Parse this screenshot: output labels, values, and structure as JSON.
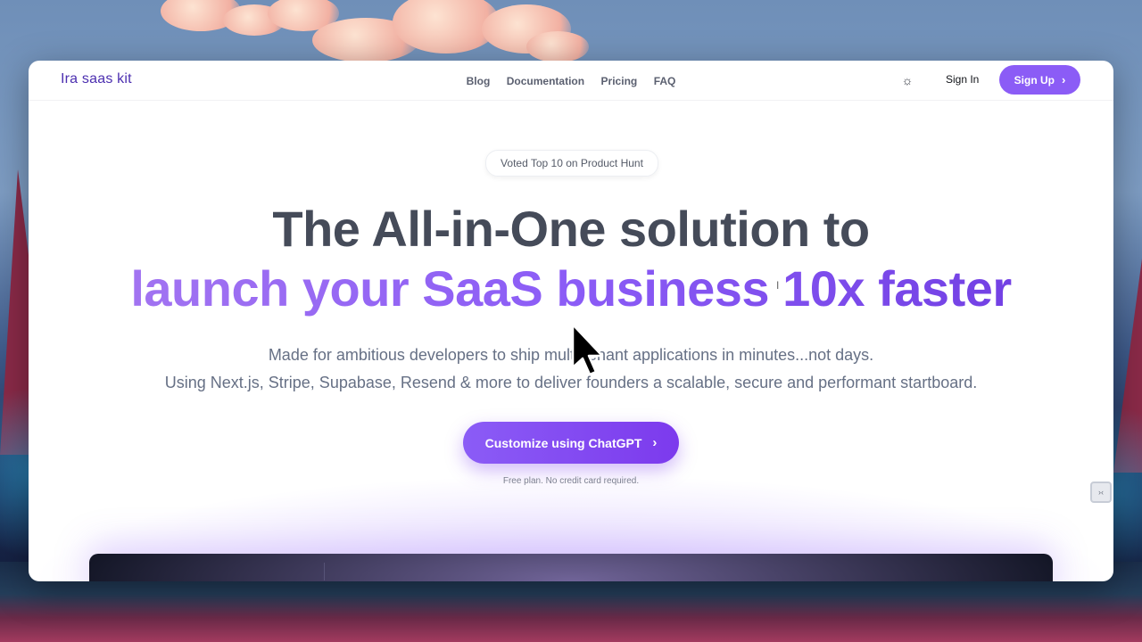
{
  "nav": {
    "logo": "Ira saas kit",
    "links": [
      "Blog",
      "Documentation",
      "Pricing",
      "FAQ"
    ],
    "theme_icon": "sun-icon",
    "sign_in": "Sign In",
    "sign_up": "Sign Up"
  },
  "hero": {
    "badge": "Voted Top 10 on Product Hunt",
    "headline_line1": "The All-in-One solution to",
    "headline_line2": "launch your SaaS business 10x faster",
    "sub_line1": "Made for ambitious developers to ship multi-tenant applications in minutes...not days.",
    "sub_line2": "Using Next.js, Stripe, Supabase, Resend & more to deliver founders a scalable, secure and performant startboard.",
    "cta": "Customize using ChatGPT",
    "fine_print": "Free plan. No credit card required."
  },
  "colors": {
    "accent": "#8b5cf6",
    "accent_dark": "#7c3aed",
    "logo": "#4c2fb0",
    "headline": "#454b59",
    "body_text": "#667085"
  },
  "icons": {
    "chevron": "chevron-right-icon",
    "cursor": "mouse-pointer-icon"
  }
}
